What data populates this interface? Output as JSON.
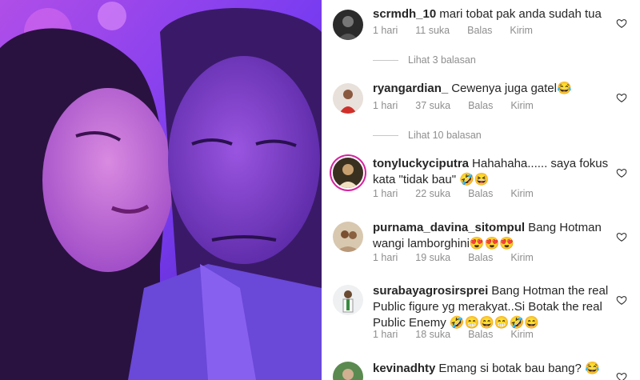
{
  "post": {
    "image_description_icon": "couple-selfie-photo"
  },
  "comments": [
    {
      "username": "scrmdh_10",
      "text": "mari tobat pak anda sudah tua",
      "time": "1 hari",
      "likes": "11 suka",
      "reply": "Balas",
      "send": "Kirim",
      "view_replies": "Lihat 3 balasan"
    },
    {
      "username": "ryangardian_",
      "text": "Cewenya juga gatel😂",
      "time": "1 hari",
      "likes": "37 suka",
      "reply": "Balas",
      "send": "Kirim",
      "view_replies": "Lihat 10 balasan"
    },
    {
      "username": "tonyluckyciputra",
      "text": "Hahahaha...... saya fokus kata \"tidak bau\" 🤣😆",
      "time": "1 hari",
      "likes": "22 suka",
      "reply": "Balas",
      "send": "Kirim"
    },
    {
      "username": "purnama_davina_sitompul",
      "text": "Bang Hotman wangi lamborghini😍😍😍",
      "time": "1 hari",
      "likes": "19 suka",
      "reply": "Balas",
      "send": "Kirim"
    },
    {
      "username": "surabayagrosirsprei",
      "text": "Bang Hotman the real Public figure yg merakyat..Si Botak the real Public Enemy 🤣😁😄😁🤣😄",
      "time": "1 hari",
      "likes": "18 suka",
      "reply": "Balas",
      "send": "Kirim"
    },
    {
      "username": "kevinadhty",
      "text": "Emang si botak bau bang? 😂"
    }
  ],
  "colors": {
    "text": "#262626",
    "meta": "#8e8e8e",
    "photo_tint": "#7a3cf0"
  }
}
